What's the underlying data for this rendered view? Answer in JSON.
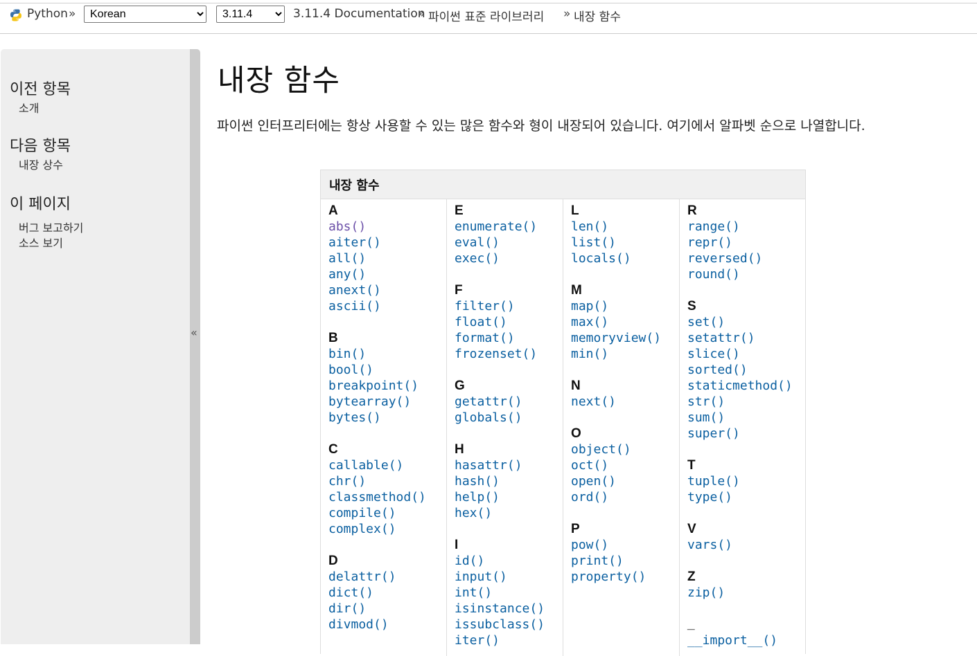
{
  "topbar": {
    "brand": "Python",
    "separator": "»",
    "language_selected": "Korean",
    "version_selected": "3.11.4",
    "breadcrumbs": [
      "3.11.4 Documentation",
      "파이썬 표준 라이브러리",
      "내장 함수"
    ]
  },
  "sidebar": {
    "prev_heading": "이전 항목",
    "prev_link": "소개",
    "next_heading": "다음 항목",
    "next_link": "내장 상수",
    "page_heading": "이 페이지",
    "report_bug": "버그 보고하기",
    "show_source": "소스 보기",
    "collapse": "«"
  },
  "main": {
    "title": "내장 함수",
    "intro": "파이썬 인터프리터에는 항상 사용할 수 있는 많은 함수와 형이 내장되어 있습니다. 여기에서 알파벳 순으로 나열합니다.",
    "table_heading": "내장 함수",
    "link_color": "#0a5fa0",
    "visited_color": "#6b4fa8",
    "columns": [
      [
        {
          "letter": "A",
          "items": [
            "abs()",
            "aiter()",
            "all()",
            "any()",
            "anext()",
            "ascii()"
          ]
        },
        {
          "letter": "B",
          "items": [
            "bin()",
            "bool()",
            "breakpoint()",
            "bytearray()",
            "bytes()"
          ]
        },
        {
          "letter": "C",
          "items": [
            "callable()",
            "chr()",
            "classmethod()",
            "compile()",
            "complex()"
          ]
        },
        {
          "letter": "D",
          "items": [
            "delattr()",
            "dict()",
            "dir()",
            "divmod()"
          ]
        }
      ],
      [
        {
          "letter": "E",
          "items": [
            "enumerate()",
            "eval()",
            "exec()"
          ]
        },
        {
          "letter": "F",
          "items": [
            "filter()",
            "float()",
            "format()",
            "frozenset()"
          ]
        },
        {
          "letter": "G",
          "items": [
            "getattr()",
            "globals()"
          ]
        },
        {
          "letter": "H",
          "items": [
            "hasattr()",
            "hash()",
            "help()",
            "hex()"
          ]
        },
        {
          "letter": "I",
          "items": [
            "id()",
            "input()",
            "int()",
            "isinstance()",
            "issubclass()",
            "iter()"
          ]
        }
      ],
      [
        {
          "letter": "L",
          "items": [
            "len()",
            "list()",
            "locals()"
          ]
        },
        {
          "letter": "M",
          "items": [
            "map()",
            "max()",
            "memoryview()",
            "min()"
          ]
        },
        {
          "letter": "N",
          "items": [
            "next()"
          ]
        },
        {
          "letter": "O",
          "items": [
            "object()",
            "oct()",
            "open()",
            "ord()"
          ]
        },
        {
          "letter": "P",
          "items": [
            "pow()",
            "print()",
            "property()"
          ]
        }
      ],
      [
        {
          "letter": "R",
          "items": [
            "range()",
            "repr()",
            "reversed()",
            "round()"
          ]
        },
        {
          "letter": "S",
          "items": [
            "set()",
            "setattr()",
            "slice()",
            "sorted()",
            "staticmethod()",
            "str()",
            "sum()",
            "super()"
          ]
        },
        {
          "letter": "T",
          "items": [
            "tuple()",
            "type()"
          ]
        },
        {
          "letter": "V",
          "items": [
            "vars()"
          ]
        },
        {
          "letter": "Z",
          "items": [
            "zip()"
          ]
        },
        {
          "letter": "_",
          "items": [
            "__import__()"
          ]
        }
      ]
    ]
  }
}
